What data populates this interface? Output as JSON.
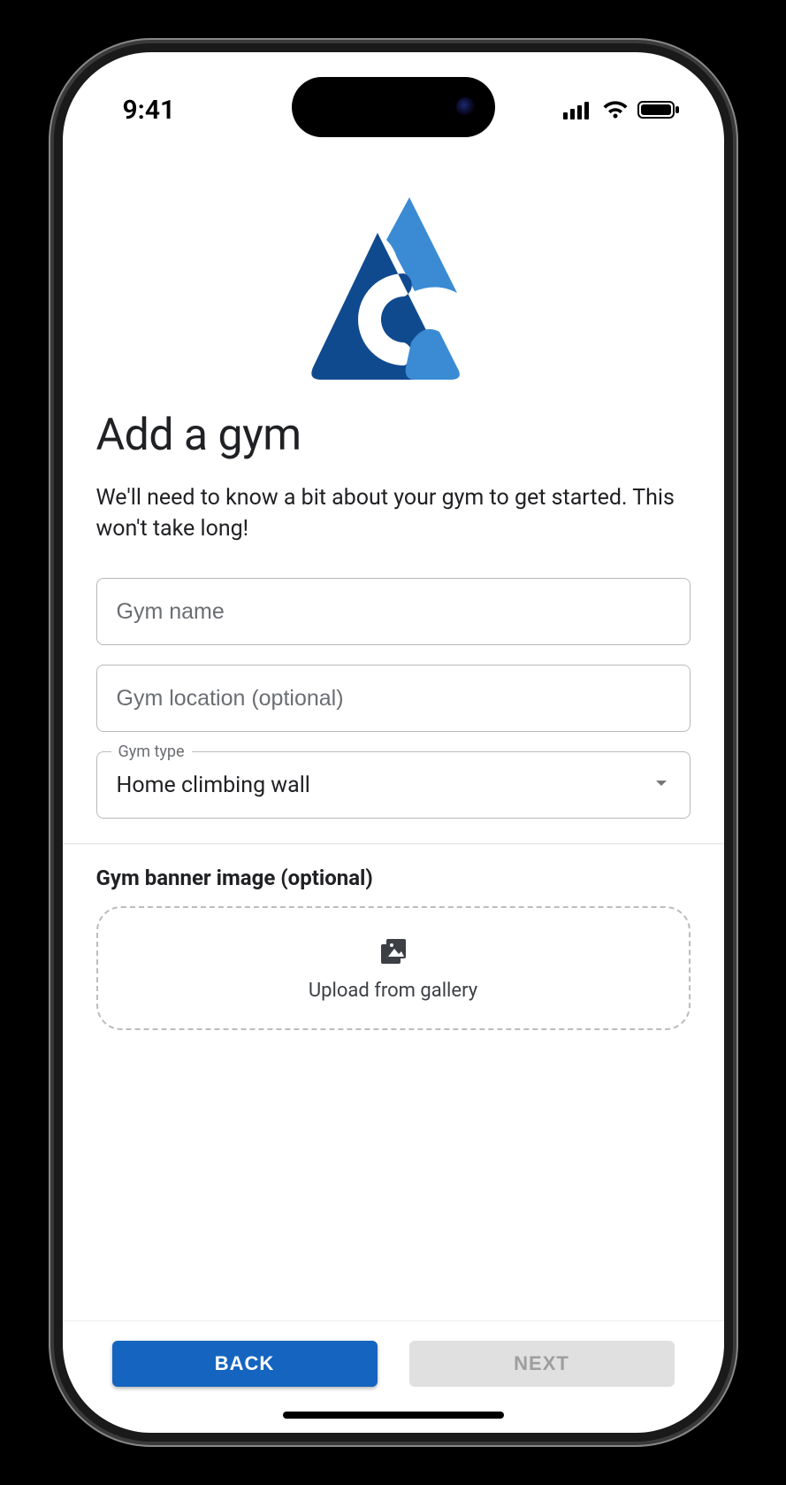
{
  "status": {
    "time": "9:41"
  },
  "page": {
    "title": "Add a gym",
    "subtitle": "We'll need to know a bit about your gym to get started. This won't take long!"
  },
  "form": {
    "gym_name": {
      "placeholder": "Gym name",
      "value": ""
    },
    "gym_location": {
      "placeholder": "Gym location (optional)",
      "value": ""
    },
    "gym_type": {
      "label": "Gym type",
      "value": "Home climbing wall"
    }
  },
  "banner": {
    "section_label": "Gym banner image (optional)",
    "upload_label": "Upload from gallery"
  },
  "footer": {
    "back_label": "BACK",
    "next_label": "NEXT",
    "next_enabled": false
  },
  "colors": {
    "primary": "#1565c0",
    "logo_dark": "#104a8e",
    "logo_light": "#3b8bd4"
  }
}
